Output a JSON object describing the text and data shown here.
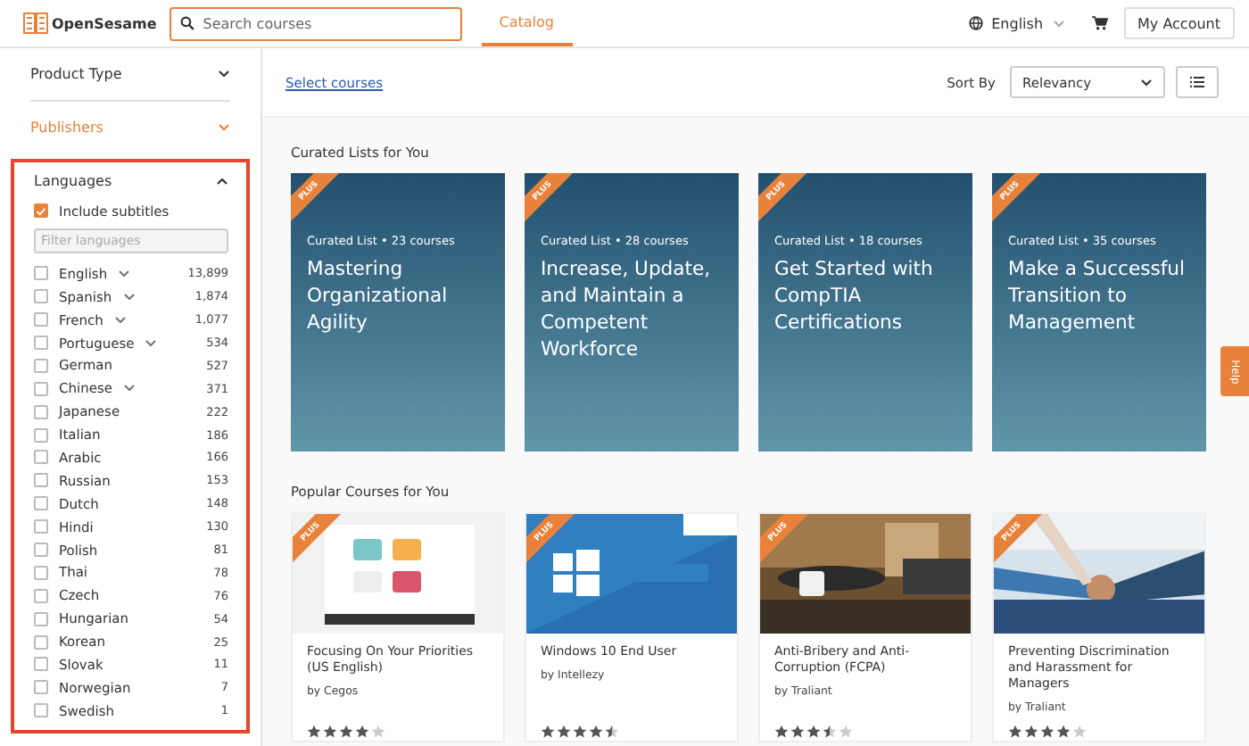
{
  "header": {
    "logo": "OpenSesame",
    "search": {
      "placeholder": "Search courses"
    },
    "nav": [
      {
        "label": "Catalog",
        "selected": true
      }
    ],
    "language": "English",
    "account_button": "My Account"
  },
  "sidebar": {
    "sections": [
      {
        "title": "Product Type",
        "expanded": false,
        "active": false
      },
      {
        "title": "Publishers",
        "expanded": false,
        "active": true
      }
    ],
    "languages": {
      "title": "Languages",
      "expanded": true,
      "highlighted": true,
      "include_subtitles": {
        "label": "Include subtitles",
        "checked": true
      },
      "filter": {
        "placeholder": "Filter languages"
      },
      "items": [
        {
          "name": "English",
          "count": "13,899",
          "checked": false,
          "expandable": true
        },
        {
          "name": "Spanish",
          "count": "1,874",
          "checked": false,
          "expandable": true
        },
        {
          "name": "French",
          "count": "1,077",
          "checked": false,
          "expandable": true
        },
        {
          "name": "Portuguese",
          "count": "534",
          "checked": false,
          "expandable": true
        },
        {
          "name": "German",
          "count": "527",
          "checked": false,
          "expandable": false
        },
        {
          "name": "Chinese",
          "count": "371",
          "checked": false,
          "expandable": true
        },
        {
          "name": "Japanese",
          "count": "222",
          "checked": false,
          "expandable": false
        },
        {
          "name": "Italian",
          "count": "186",
          "checked": false,
          "expandable": false
        },
        {
          "name": "Arabic",
          "count": "166",
          "checked": false,
          "expandable": false
        },
        {
          "name": "Russian",
          "count": "153",
          "checked": false,
          "expandable": false
        },
        {
          "name": "Dutch",
          "count": "148",
          "checked": false,
          "expandable": false
        },
        {
          "name": "Hindi",
          "count": "130",
          "checked": false,
          "expandable": false
        },
        {
          "name": "Polish",
          "count": "81",
          "checked": false,
          "expandable": false
        },
        {
          "name": "Thai",
          "count": "78",
          "checked": false,
          "expandable": false
        },
        {
          "name": "Czech",
          "count": "76",
          "checked": false,
          "expandable": false
        },
        {
          "name": "Hungarian",
          "count": "54",
          "checked": false,
          "expandable": false
        },
        {
          "name": "Korean",
          "count": "25",
          "checked": false,
          "expandable": false
        },
        {
          "name": "Slovak",
          "count": "11",
          "checked": false,
          "expandable": false
        },
        {
          "name": "Norwegian",
          "count": "7",
          "checked": false,
          "expandable": false
        },
        {
          "name": "Swedish",
          "count": "1",
          "checked": false,
          "expandable": false
        }
      ]
    }
  },
  "toolbar": {
    "select_link": "Select courses",
    "sort_label": "Sort By",
    "sort_value": "Relevancy"
  },
  "curated": {
    "title": "Curated Lists for You",
    "cards": [
      {
        "badge": "PLUS",
        "meta": "Curated List • 23 courses",
        "title": "Mastering Organizational Agility"
      },
      {
        "badge": "PLUS",
        "meta": "Curated List • 28 courses",
        "title": "Increase, Update, and Maintain a Competent Workforce"
      },
      {
        "badge": "PLUS",
        "meta": "Curated List • 18 courses",
        "title": "Get Started with CompTIA Certifications"
      },
      {
        "badge": "PLUS",
        "meta": "Curated List • 35 courses",
        "title": "Make a Successful Transition to Management"
      }
    ]
  },
  "popular": {
    "title": "Popular Courses for You",
    "cards": [
      {
        "badge": "PLUS",
        "title": "Focusing On Your Priorities (US English)",
        "publisher": "by Cegos",
        "stars": 4
      },
      {
        "badge": "PLUS",
        "title": "Windows 10 End User",
        "publisher": "by Intellezy",
        "stars": 4.5
      },
      {
        "badge": "PLUS",
        "title": "Anti-Bribery and Anti-Corruption (FCPA)",
        "publisher": "by Traliant",
        "stars": 3.5
      },
      {
        "badge": "PLUS",
        "title": "Preventing Discrimination and Harassment for Managers",
        "publisher": "by Traliant",
        "stars": 4
      }
    ]
  },
  "help": "Help"
}
